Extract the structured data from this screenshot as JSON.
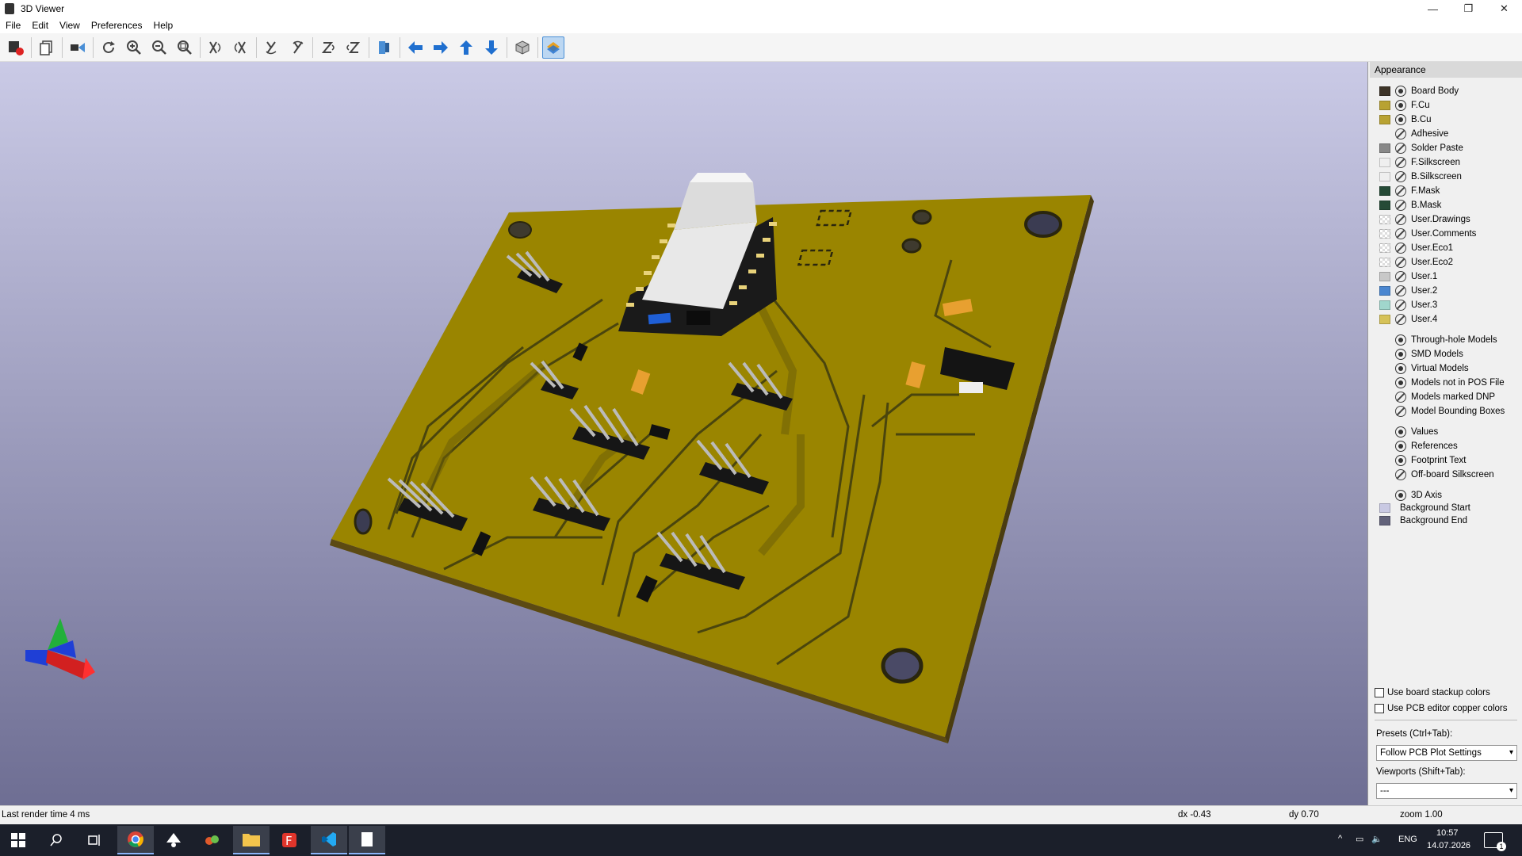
{
  "window": {
    "title": "3D Viewer",
    "controls": [
      "—",
      "❐",
      "✕"
    ]
  },
  "menu": [
    "File",
    "Edit",
    "View",
    "Preferences",
    "Help"
  ],
  "toolbar": {
    "buttons": [
      "render-options",
      "export",
      "copy",
      "raytrace",
      "reload",
      "zoom-in",
      "zoom-out",
      "zoom-fit",
      "rotate-x-cw",
      "rotate-x-ccw",
      "rotate-y-cw",
      "rotate-y-ccw",
      "rotate-z-cw",
      "rotate-z-ccw",
      "flip",
      "move-left",
      "move-right",
      "move-up",
      "move-down",
      "ortho",
      "layers"
    ]
  },
  "appearance": {
    "header": "Appearance",
    "layers": [
      {
        "name": "Board Body",
        "color": "#3d3428",
        "visible": true
      },
      {
        "name": "F.Cu",
        "color": "#b8a232",
        "visible": true
      },
      {
        "name": "B.Cu",
        "color": "#b8a232",
        "visible": true
      },
      {
        "name": "Adhesive",
        "color": "",
        "visible": false
      },
      {
        "name": "Solder Paste",
        "color": "#888888",
        "visible": false
      },
      {
        "name": "F.Silkscreen",
        "color": "#efefef",
        "visible": false
      },
      {
        "name": "B.Silkscreen",
        "color": "#efefef",
        "visible": false
      },
      {
        "name": "F.Mask",
        "color": "#254a36",
        "visible": false
      },
      {
        "name": "B.Mask",
        "color": "#254a36",
        "visible": false
      },
      {
        "name": "User.Drawings",
        "color": "checker",
        "visible": false
      },
      {
        "name": "User.Comments",
        "color": "checker",
        "visible": false
      },
      {
        "name": "User.Eco1",
        "color": "checker",
        "visible": false
      },
      {
        "name": "User.Eco2",
        "color": "checker",
        "visible": false
      },
      {
        "name": "User.1",
        "color": "#c8c8c8",
        "visible": false
      },
      {
        "name": "User.2",
        "color": "#4a86d0",
        "visible": false
      },
      {
        "name": "User.3",
        "color": "#a0d6cc",
        "visible": false
      },
      {
        "name": "User.4",
        "color": "#d6c258",
        "visible": false
      }
    ],
    "models": [
      {
        "name": "Through-hole Models",
        "visible": true
      },
      {
        "name": "SMD Models",
        "visible": true
      },
      {
        "name": "Virtual Models",
        "visible": true
      },
      {
        "name": "Models not in POS File",
        "visible": true
      },
      {
        "name": "Models marked DNP",
        "visible": false
      },
      {
        "name": "Model Bounding Boxes",
        "visible": false
      }
    ],
    "texts": [
      {
        "name": "Values",
        "visible": true
      },
      {
        "name": "References",
        "visible": true
      },
      {
        "name": "Footprint Text",
        "visible": true
      },
      {
        "name": "Off-board Silkscreen",
        "visible": false
      }
    ],
    "other": [
      {
        "name": "3D Axis",
        "visible": true,
        "color": ""
      },
      {
        "name": "Background Start",
        "visible": null,
        "color": "#c9c9e3"
      },
      {
        "name": "Background End",
        "visible": null,
        "color": "#62627a"
      }
    ],
    "options": [
      {
        "label": "Use board stackup colors",
        "checked": false
      },
      {
        "label": "Use PCB editor copper colors",
        "checked": false
      }
    ],
    "presets_label": "Presets (Ctrl+Tab):",
    "presets_value": "Follow PCB Plot Settings",
    "viewports_label": "Viewports (Shift+Tab):",
    "viewports_value": "---"
  },
  "status": {
    "render_time": "Last render time 4 ms",
    "dx": "dx -0.43",
    "dy": "dy 0.70",
    "zoom": "zoom 1.00"
  },
  "taskbar": {
    "apps": [
      "start",
      "search",
      "task-view",
      "chrome",
      "inkscape",
      "app",
      "explorer",
      "app-f",
      "vscode",
      "notepad"
    ],
    "lang": "ENG",
    "time": "10:57",
    "date": "14.07.2026",
    "notifications": "1"
  }
}
